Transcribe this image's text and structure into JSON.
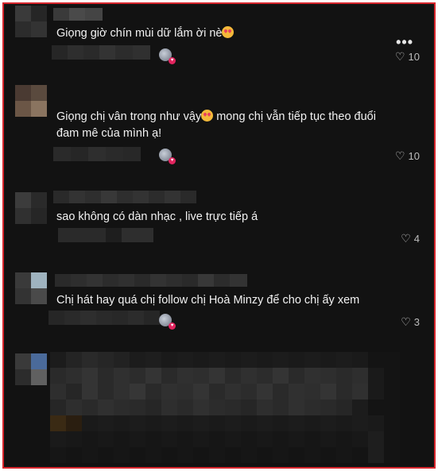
{
  "comments": [
    {
      "text": "Giọng giờ chín mùi dữ lắm ời nè",
      "emoji": "heart-eyes-emoji",
      "likes": "10"
    },
    {
      "text_part1": "Giọng chị vân trong như vậy",
      "text_part2": " mong chị vẫn tiếp tục theo đuổi đam mê của mình ạ!",
      "emoji": "heart-eyes-emoji",
      "likes": "10"
    },
    {
      "text": "sao không có dàn nhạc , live trực tiếp á",
      "likes": "4"
    },
    {
      "text": "Chị hát hay quá chị follow chị Hoà Minzy để cho chị ấy xem",
      "likes": "3"
    }
  ],
  "icons": {
    "more": "more-options-icon",
    "like": "heart-outline-icon",
    "creator_badge": "creator-liked-badge-icon"
  },
  "colors": {
    "background": "#121212",
    "border": "#d7262d",
    "text": "#f2f2f2",
    "muted": "#bdbdbd",
    "badge": "#e0245e"
  },
  "more_label": "•••"
}
